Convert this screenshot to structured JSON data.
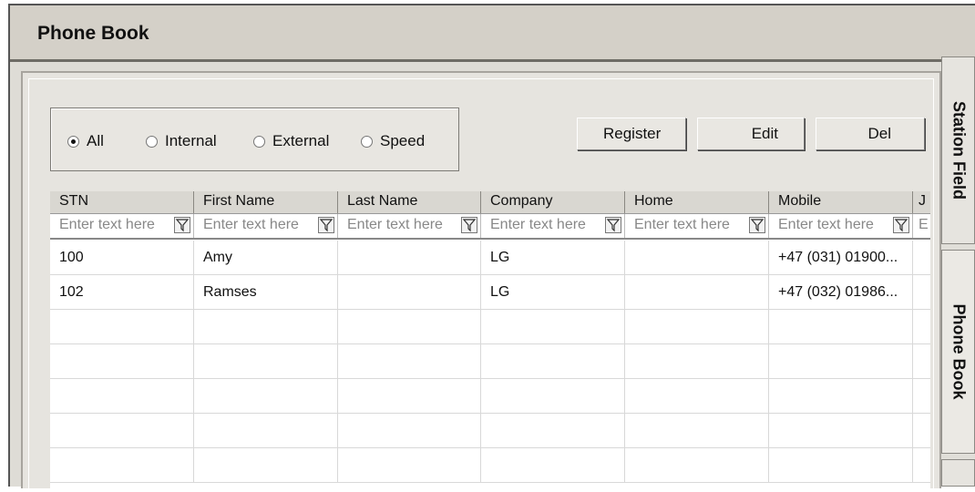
{
  "window": {
    "title": "Phone Book"
  },
  "filter": {
    "options": [
      {
        "label": "All",
        "checked": true
      },
      {
        "label": "Internal",
        "checked": false
      },
      {
        "label": "External",
        "checked": false
      },
      {
        "label": "Speed",
        "checked": false
      }
    ]
  },
  "toolbar": {
    "register_label": "Register",
    "edit_label": "Edit",
    "del_label": "Del"
  },
  "table": {
    "columns": [
      "STN",
      "First Name",
      "Last Name",
      "Company",
      "Home",
      "Mobile",
      "J"
    ],
    "filter_placeholder": "Enter text here",
    "last_filter_placeholder": "E",
    "rows": [
      [
        "100",
        "Amy",
        "",
        "LG",
        "",
        "+47 (031) 01900...",
        ""
      ],
      [
        "102",
        "Ramses",
        "",
        "LG",
        "",
        "+47 (032) 01986...",
        ""
      ]
    ]
  },
  "side_tabs": [
    "Station Field",
    "Phone Book"
  ]
}
